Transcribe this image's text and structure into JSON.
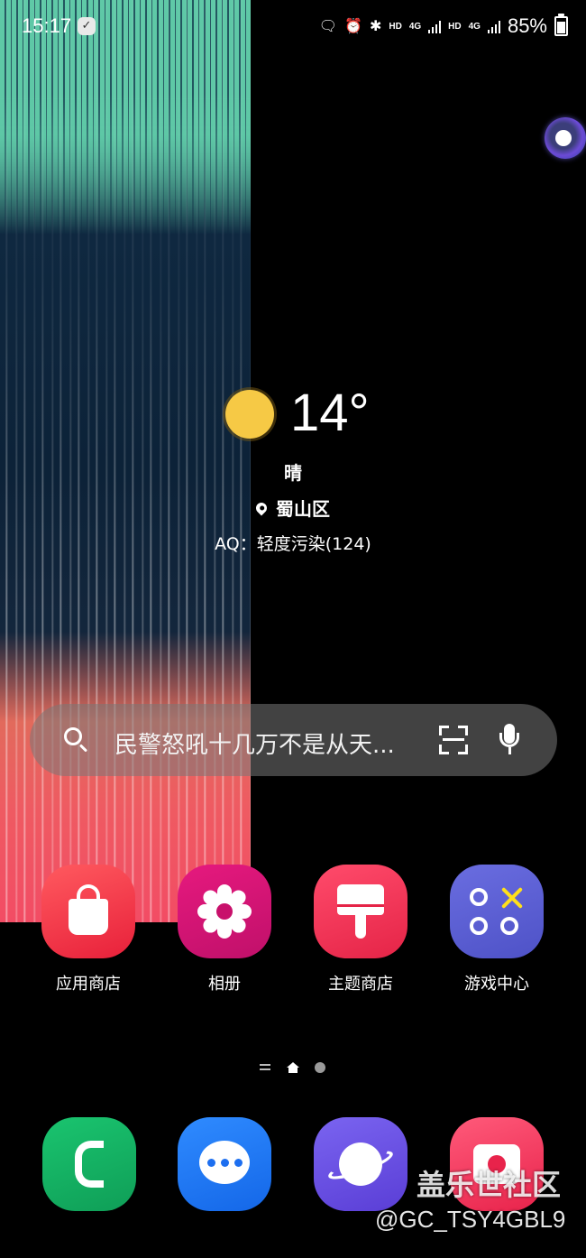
{
  "status_bar": {
    "time": "15:17",
    "network_1": "HD",
    "network_1_gen": "4G",
    "network_2": "HD",
    "network_2_gen": "4G",
    "battery": "85%"
  },
  "weather": {
    "temperature": "14°",
    "condition": "晴",
    "location": "蜀山区",
    "aqi": "AQ：轻度污染(124)",
    "icon": "sun-icon"
  },
  "search": {
    "hint": "民警怒吼十几万不是从天..."
  },
  "apps": [
    {
      "label": "应用商店",
      "icon": "shopping-bag-icon",
      "color": "#ff4a55"
    },
    {
      "label": "相册",
      "icon": "flower-icon",
      "color": "#d9157a"
    },
    {
      "label": "主题商店",
      "icon": "paint-brush-icon",
      "color": "#f23656"
    },
    {
      "label": "游戏中心",
      "icon": "game-controller-icon",
      "color": "#5c5fd6"
    }
  ],
  "dock": [
    {
      "name": "phone",
      "icon": "phone-icon",
      "color": "#14b865"
    },
    {
      "name": "messages",
      "icon": "chat-bubble-icon",
      "color": "#2279f5"
    },
    {
      "name": "browser",
      "icon": "planet-icon",
      "color": "#6a50e5"
    },
    {
      "name": "camera",
      "icon": "camera-icon",
      "color": "#f23a5c"
    }
  ],
  "watermark": {
    "brand": "盖乐世社区",
    "user": "@GC_TSY4GBL9"
  }
}
